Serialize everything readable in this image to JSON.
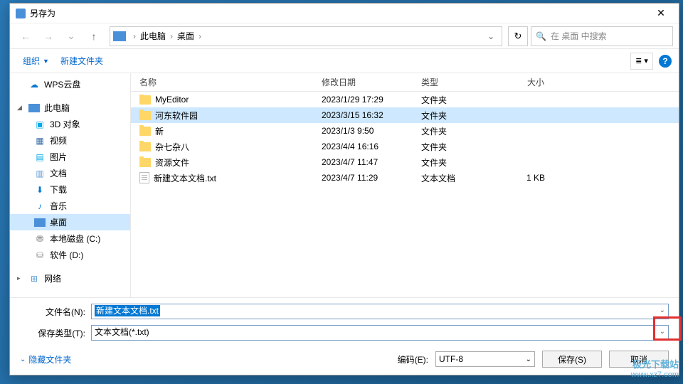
{
  "dialog": {
    "title": "另存为"
  },
  "nav": {
    "breadcrumb": {
      "root": "此电脑",
      "path1": "桌面"
    },
    "search_placeholder": "在 桌面 中搜索"
  },
  "toolbar": {
    "organize": "组织",
    "new_folder": "新建文件夹"
  },
  "sidebar": {
    "wps": "WPS云盘",
    "pc": "此电脑",
    "obj3d": "3D 对象",
    "video": "视频",
    "pics": "图片",
    "docs": "文档",
    "downloads": "下载",
    "music": "音乐",
    "desktop": "桌面",
    "drive_c": "本地磁盘 (C:)",
    "drive_d": "软件 (D:)",
    "network": "网络"
  },
  "columns": {
    "name": "名称",
    "date": "修改日期",
    "type": "类型",
    "size": "大小"
  },
  "files": [
    {
      "name": "MyEditor",
      "date": "2023/1/29 17:29",
      "type": "文件夹",
      "size": "",
      "kind": "folder"
    },
    {
      "name": "河东软件园",
      "date": "2023/3/15 16:32",
      "type": "文件夹",
      "size": "",
      "kind": "folder",
      "selected": true
    },
    {
      "name": "新",
      "date": "2023/1/3 9:50",
      "type": "文件夹",
      "size": "",
      "kind": "folder"
    },
    {
      "name": "杂七杂八",
      "date": "2023/4/4 16:16",
      "type": "文件夹",
      "size": "",
      "kind": "folder"
    },
    {
      "name": "资源文件",
      "date": "2023/4/7 11:47",
      "type": "文件夹",
      "size": "",
      "kind": "folder"
    },
    {
      "name": "新建文本文档.txt",
      "date": "2023/4/7 11:29",
      "type": "文本文档",
      "size": "1 KB",
      "kind": "txt"
    }
  ],
  "fields": {
    "filename_label": "文件名(N):",
    "filename_value": "新建文本文档.txt",
    "savetype_label": "保存类型(T):",
    "savetype_value": "文本文档(*.txt)"
  },
  "footer": {
    "hide_folders": "隐藏文件夹",
    "encoding_label": "编码(E):",
    "encoding_value": "UTF-8",
    "save": "保存(S)",
    "cancel": "取消"
  },
  "watermark": {
    "name": "极光下载站",
    "url": "www.xz7.com"
  }
}
